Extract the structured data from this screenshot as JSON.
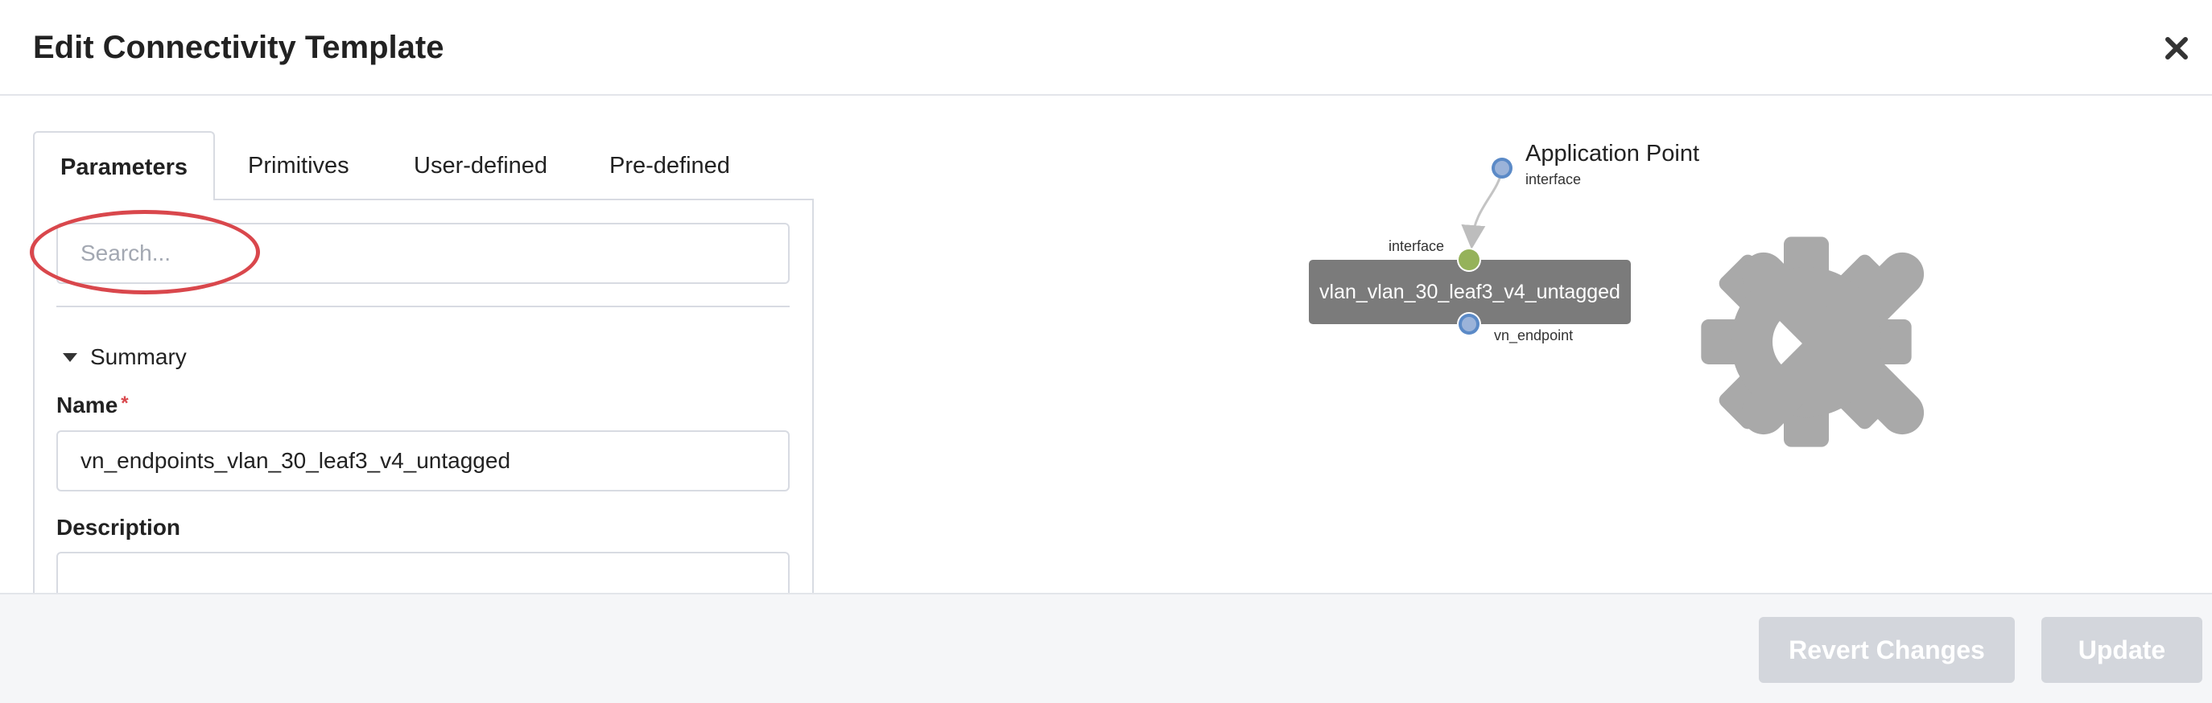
{
  "header": {
    "title": "Edit Connectivity Template"
  },
  "tabs": [
    {
      "label": "Parameters",
      "active": true
    },
    {
      "label": "Primitives",
      "active": false
    },
    {
      "label": "User-defined",
      "active": false
    },
    {
      "label": "Pre-defined",
      "active": false
    }
  ],
  "search": {
    "placeholder": "Search...",
    "value": ""
  },
  "summary": {
    "label": "Summary",
    "expanded": true
  },
  "name_field": {
    "label": "Name",
    "required_marker": "*",
    "value": "vn_endpoints_vlan_30_leaf3_v4_untagged"
  },
  "description_field": {
    "label": "Description",
    "value": ""
  },
  "diagram": {
    "app_point": {
      "title": "Application Point",
      "subtitle": "interface"
    },
    "node": {
      "label": "vlan_vlan_30_leaf3_v4_untagged",
      "input_port_label": "interface",
      "output_port_label": "vn_endpoint"
    }
  },
  "footer": {
    "revert_label": "Revert Changes",
    "update_label": "Update"
  },
  "colors": {
    "highlight_ring": "#d9474c",
    "app_point_port": "#5b8ac7",
    "input_port": "#95b25a",
    "node_fill": "#7b7b7b",
    "disabled_button": "#d3d6dc"
  },
  "icons": {
    "close": "close-icon",
    "caret": "caret-down-icon",
    "gear": "gear-icon",
    "remove": "remove-icon"
  }
}
